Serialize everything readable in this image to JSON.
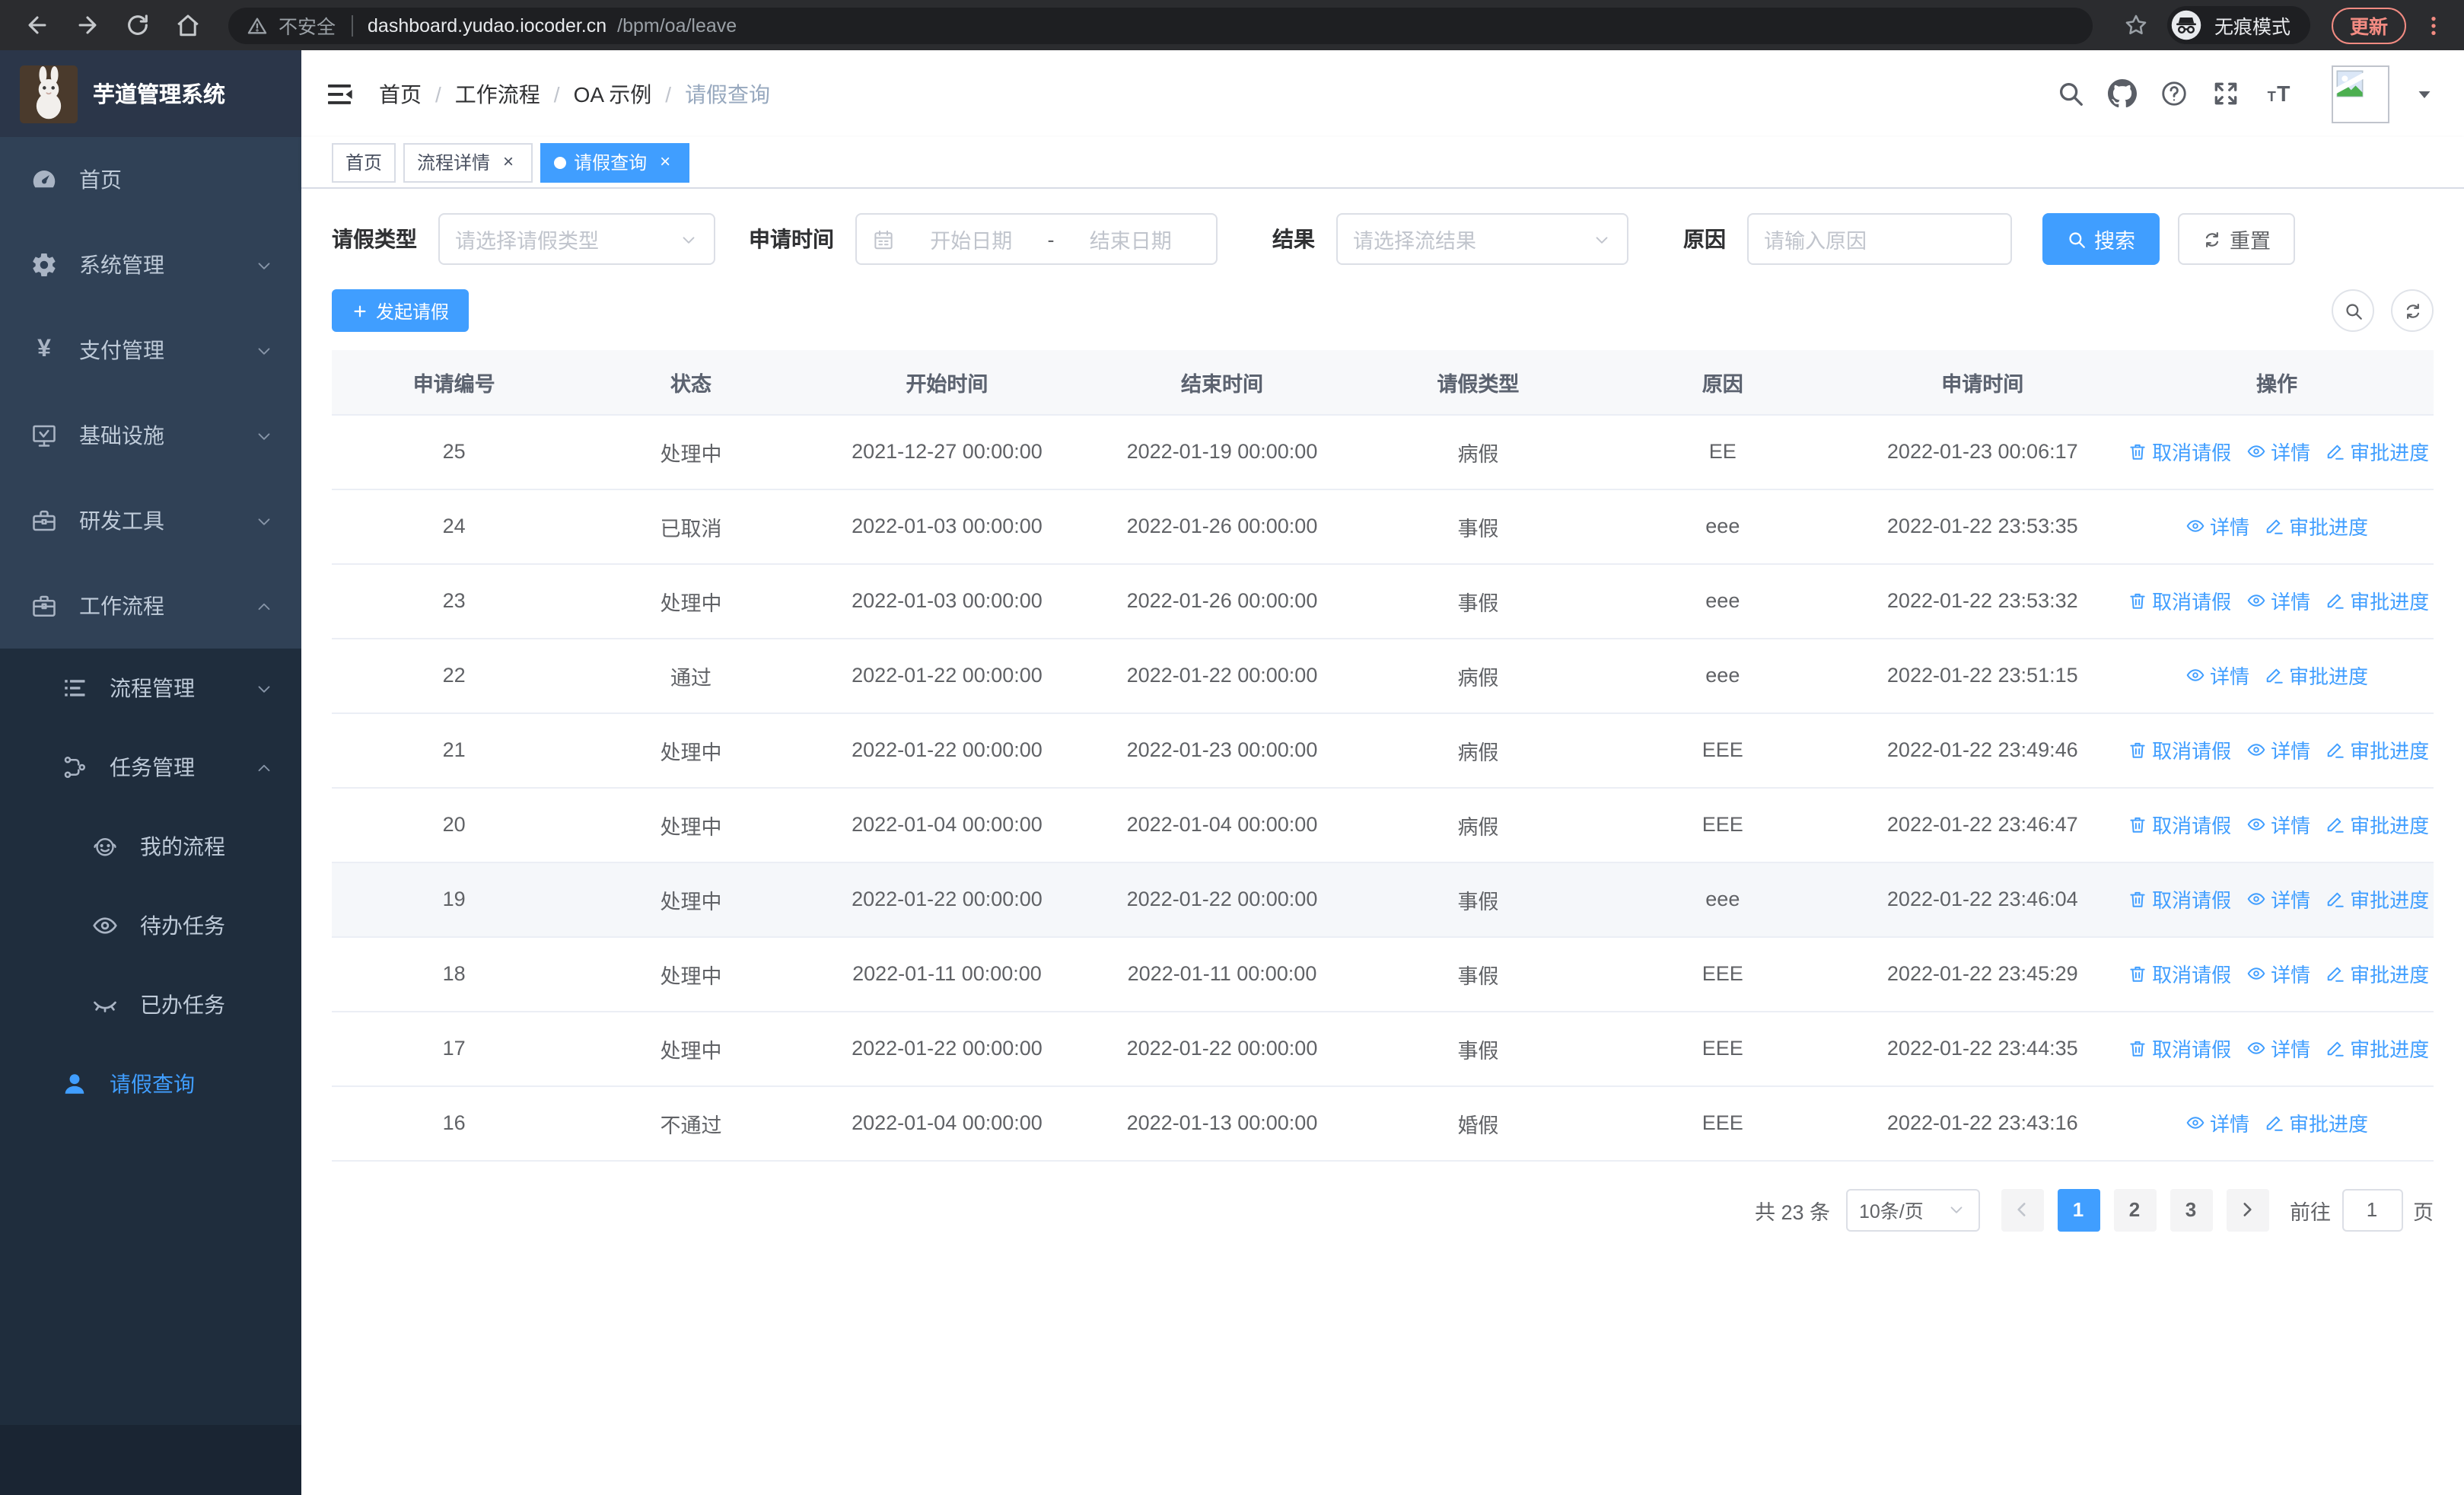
{
  "colors": {
    "primary": "#409EFF",
    "sidebar_bg": "#304156",
    "submenu_bg": "#1f2d3d",
    "browser_accent": "#f28b82"
  },
  "browser": {
    "security_warning": "不安全",
    "url_host": "dashboard.yudao.iocoder.cn",
    "url_path": "/bpm/oa/leave",
    "incognito_label": "无痕模式",
    "update_label": "更新"
  },
  "sidebar": {
    "title": "芋道管理系统",
    "menu": [
      {
        "label": "首页",
        "icon": "dashboard-icon",
        "level": 1,
        "chevron": null,
        "active": false
      },
      {
        "label": "系统管理",
        "icon": "gear-icon",
        "level": 1,
        "chevron": "down",
        "active": false
      },
      {
        "label": "支付管理",
        "icon": "yen-icon",
        "level": 1,
        "chevron": "down",
        "active": false
      },
      {
        "label": "基础设施",
        "icon": "monitor-icon",
        "level": 1,
        "chevron": "down",
        "active": false
      },
      {
        "label": "研发工具",
        "icon": "toolbox-icon",
        "level": 1,
        "chevron": "down",
        "active": false
      },
      {
        "label": "工作流程",
        "icon": "briefcase-icon",
        "level": 1,
        "chevron": "up",
        "active": false
      },
      {
        "label": "流程管理",
        "icon": "list-icon",
        "level": 2,
        "chevron": "down",
        "active": false
      },
      {
        "label": "任务管理",
        "icon": "branch-icon",
        "level": 2,
        "chevron": "up",
        "active": false
      },
      {
        "label": "我的流程",
        "icon": "robot-icon",
        "level": 3,
        "chevron": null,
        "active": false
      },
      {
        "label": "待办任务",
        "icon": "eye-icon",
        "level": 3,
        "chevron": null,
        "active": false
      },
      {
        "label": "已办任务",
        "icon": "eye-off-icon",
        "level": 3,
        "chevron": null,
        "active": false
      },
      {
        "label": "请假查询",
        "icon": "user-icon",
        "level": 2,
        "chevron": null,
        "active": true
      }
    ]
  },
  "header": {
    "breadcrumb": [
      "首页",
      "工作流程",
      "OA 示例",
      "请假查询"
    ]
  },
  "tabs": [
    {
      "label": "首页",
      "closable": false,
      "active": false
    },
    {
      "label": "流程详情",
      "closable": true,
      "active": false
    },
    {
      "label": "请假查询",
      "closable": true,
      "active": true
    }
  ],
  "filters": {
    "leave_type_label": "请假类型",
    "leave_type_placeholder": "请选择请假类型",
    "apply_time_label": "申请时间",
    "start_date_placeholder": "开始日期",
    "date_separator": "-",
    "end_date_placeholder": "结束日期",
    "result_label": "结果",
    "result_placeholder": "请选择流结果",
    "reason_label": "原因",
    "reason_placeholder": "请输入原因",
    "search_label": "搜索",
    "reset_label": "重置"
  },
  "toolbar": {
    "create_label": "发起请假"
  },
  "table": {
    "columns": [
      "申请编号",
      "状态",
      "开始时间",
      "结束时间",
      "请假类型",
      "原因",
      "申请时间",
      "操作"
    ],
    "action_labels": {
      "cancel": "取消请假",
      "detail": "详情",
      "progress": "审批进度"
    },
    "rows": [
      {
        "id": "25",
        "status": "处理中",
        "start": "2021-12-27 00:00:00",
        "end": "2022-01-19 00:00:00",
        "type": "病假",
        "reason": "EE",
        "applied": "2022-01-23 00:06:17",
        "actions": [
          "cancel",
          "detail",
          "progress"
        ],
        "hover": false
      },
      {
        "id": "24",
        "status": "已取消",
        "start": "2022-01-03 00:00:00",
        "end": "2022-01-26 00:00:00",
        "type": "事假",
        "reason": "eee",
        "applied": "2022-01-22 23:53:35",
        "actions": [
          "detail",
          "progress"
        ],
        "hover": false
      },
      {
        "id": "23",
        "status": "处理中",
        "start": "2022-01-03 00:00:00",
        "end": "2022-01-26 00:00:00",
        "type": "事假",
        "reason": "eee",
        "applied": "2022-01-22 23:53:32",
        "actions": [
          "cancel",
          "detail",
          "progress"
        ],
        "hover": false
      },
      {
        "id": "22",
        "status": "通过",
        "start": "2022-01-22 00:00:00",
        "end": "2022-01-22 00:00:00",
        "type": "病假",
        "reason": "eee",
        "applied": "2022-01-22 23:51:15",
        "actions": [
          "detail",
          "progress"
        ],
        "hover": false
      },
      {
        "id": "21",
        "status": "处理中",
        "start": "2022-01-22 00:00:00",
        "end": "2022-01-23 00:00:00",
        "type": "病假",
        "reason": "EEE",
        "applied": "2022-01-22 23:49:46",
        "actions": [
          "cancel",
          "detail",
          "progress"
        ],
        "hover": false
      },
      {
        "id": "20",
        "status": "处理中",
        "start": "2022-01-04 00:00:00",
        "end": "2022-01-04 00:00:00",
        "type": "病假",
        "reason": "EEE",
        "applied": "2022-01-22 23:46:47",
        "actions": [
          "cancel",
          "detail",
          "progress"
        ],
        "hover": false
      },
      {
        "id": "19",
        "status": "处理中",
        "start": "2022-01-22 00:00:00",
        "end": "2022-01-22 00:00:00",
        "type": "事假",
        "reason": "eee",
        "applied": "2022-01-22 23:46:04",
        "actions": [
          "cancel",
          "detail",
          "progress"
        ],
        "hover": true
      },
      {
        "id": "18",
        "status": "处理中",
        "start": "2022-01-11 00:00:00",
        "end": "2022-01-11 00:00:00",
        "type": "事假",
        "reason": "EEE",
        "applied": "2022-01-22 23:45:29",
        "actions": [
          "cancel",
          "detail",
          "progress"
        ],
        "hover": false
      },
      {
        "id": "17",
        "status": "处理中",
        "start": "2022-01-22 00:00:00",
        "end": "2022-01-22 00:00:00",
        "type": "事假",
        "reason": "EEE",
        "applied": "2022-01-22 23:44:35",
        "actions": [
          "cancel",
          "detail",
          "progress"
        ],
        "hover": false
      },
      {
        "id": "16",
        "status": "不通过",
        "start": "2022-01-04 00:00:00",
        "end": "2022-01-13 00:00:00",
        "type": "婚假",
        "reason": "EEE",
        "applied": "2022-01-22 23:43:16",
        "actions": [
          "detail",
          "progress"
        ],
        "hover": false
      }
    ]
  },
  "pagination": {
    "total_text": "共 23 条",
    "page_size": "10条/页",
    "pages": [
      "1",
      "2",
      "3"
    ],
    "active_page": "1",
    "goto_label": "前往",
    "goto_value": "1",
    "page_unit": "页"
  }
}
